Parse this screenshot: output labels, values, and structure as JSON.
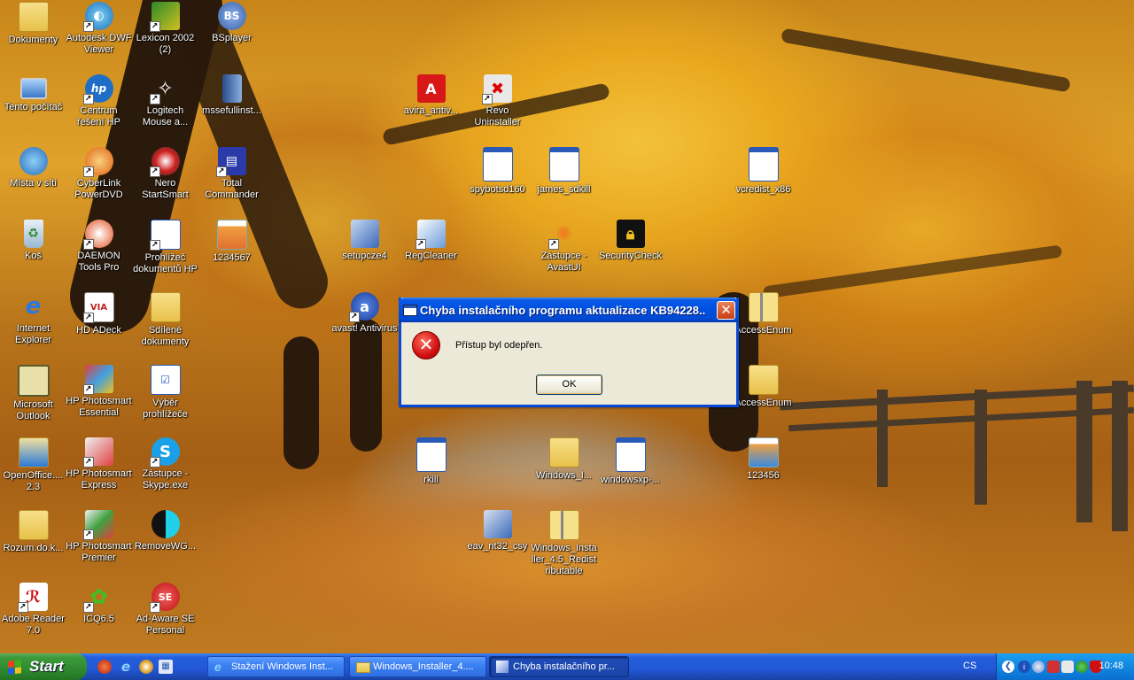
{
  "desktop": {
    "icons": [
      {
        "label": "Dokumenty"
      },
      {
        "label": "Autodesk DWF Viewer"
      },
      {
        "label": "Lexicon 2002 (2)"
      },
      {
        "label": "BSplayer"
      },
      {
        "label": "Tento počítač"
      },
      {
        "label": "Centrum řešení HP"
      },
      {
        "label": "Logitech Mouse a..."
      },
      {
        "label": "mssefullinst..."
      },
      {
        "label": "avira_antiv..."
      },
      {
        "label": "Revo Uninstaller"
      },
      {
        "label": "Místa v síti"
      },
      {
        "label": "CyberLink PowerDVD"
      },
      {
        "label": "Nero StartSmart"
      },
      {
        "label": "Total Commander"
      },
      {
        "label": "spybotsd160"
      },
      {
        "label": "james_sdkill"
      },
      {
        "label": "vcredist_x86"
      },
      {
        "label": "Koš"
      },
      {
        "label": "DAEMON Tools Pro"
      },
      {
        "label": "Prohlížeč dokumentů HP"
      },
      {
        "label": "1234567"
      },
      {
        "label": "setupcze4"
      },
      {
        "label": "RegCleaner"
      },
      {
        "label": "Zástupce - AvastUI"
      },
      {
        "label": "SecurityCheck"
      },
      {
        "label": "Internet Explorer"
      },
      {
        "label": "HD ADeck"
      },
      {
        "label": "Sdílené dokumenty"
      },
      {
        "label": "avast! Antivirus"
      },
      {
        "label": "AccessEnum"
      },
      {
        "label": "Microsoft Outlook"
      },
      {
        "label": "HP Photosmart Essential"
      },
      {
        "label": "Výběr prohlížeče"
      },
      {
        "label": "AccessEnum"
      },
      {
        "label": "OpenOffice.... 2.3"
      },
      {
        "label": "HP Photosmart Express"
      },
      {
        "label": "Zástupce - Skype.exe"
      },
      {
        "label": "rkill"
      },
      {
        "label": "Windows_I..."
      },
      {
        "label": "windowsxp-..."
      },
      {
        "label": "123456"
      },
      {
        "label": "Rozum.do.k..."
      },
      {
        "label": "HP Photosmart Premier"
      },
      {
        "label": "RemoveWG..."
      },
      {
        "label": "eav_nt32_csy"
      },
      {
        "label": "Windows_Installer_4.5_Redistributable"
      },
      {
        "label": "Adobe Reader 7.0"
      },
      {
        "label": "ICQ6.5"
      },
      {
        "label": "Ad-Aware SE Personal"
      }
    ]
  },
  "dialog": {
    "title": "Chyba instalačního programu aktualizace KB94228...",
    "message": "Přístup byl odepřen.",
    "ok_label": "OK",
    "close_glyph": "✕",
    "icon": "error-icon"
  },
  "taskbar": {
    "start_label": "Start",
    "tasks": [
      {
        "label": "Stažení Windows Inst..."
      },
      {
        "label": "Windows_Installer_4...."
      },
      {
        "label": "Chyba instalačního pr..."
      }
    ],
    "language": "CS",
    "clock": "10:48"
  },
  "colors": {
    "taskbar_blue": "#245edb",
    "start_green": "#3c9a3c",
    "title_blue": "#0050e0",
    "error_red": "#d01010"
  }
}
